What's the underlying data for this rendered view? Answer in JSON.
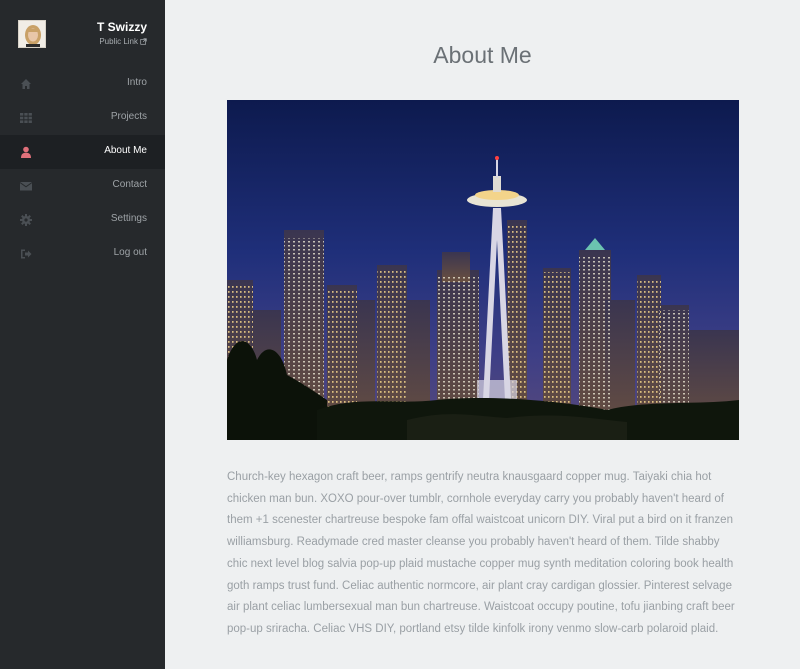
{
  "profile": {
    "name": "T Swizzy",
    "public_link": "Public Link"
  },
  "nav": {
    "items": [
      {
        "label": "Intro",
        "icon": "home-icon"
      },
      {
        "label": "Projects",
        "icon": "grid-icon"
      },
      {
        "label": "About Me",
        "icon": "user-icon",
        "active": true
      },
      {
        "label": "Contact",
        "icon": "envelope-icon"
      },
      {
        "label": "Settings",
        "icon": "gear-icon"
      },
      {
        "label": "Log out",
        "icon": "logout-icon"
      }
    ],
    "active_icon_color": "#e0707a"
  },
  "main": {
    "title": "About Me",
    "body": "Church-key hexagon craft beer, ramps gentrify neutra knausgaard copper mug. Taiyaki chia hot chicken man bun. XOXO pour-over tumblr, cornhole everyday carry you probably haven't heard of them +1 scenester chartreuse bespoke fam offal waistcoat unicorn DIY. Viral put a bird on it franzen williamsburg. Readymade cred master cleanse you probably haven't heard of them. Tilde shabby chic next level blog salvia pop-up plaid mustache copper mug synth meditation coloring book health goth ramps trust fund. Celiac authentic normcore, air plant cray cardigan glossier. Pinterest selvage air plant celiac lumbersexual man bun chartreuse. Waistcoat occupy poutine, tofu jianbing craft beer pop-up sriracha. Celiac VHS DIY, portland etsy tilde kinfolk irony venmo slow-carb polaroid plaid."
  }
}
